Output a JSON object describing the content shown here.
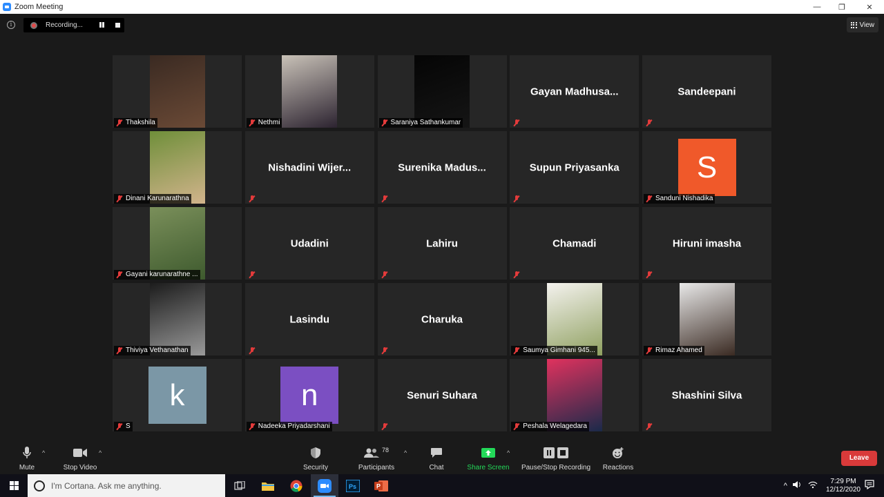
{
  "window": {
    "title": "Zoom Meeting",
    "minimize": "—",
    "maximize": "❐",
    "close": "✕"
  },
  "topbar": {
    "recording_label": "Recording...",
    "view_label": "View"
  },
  "tiles": [
    {
      "label": "Thakshila",
      "display": "photo",
      "colors": [
        "#3a2a22",
        "#6b4a36"
      ]
    },
    {
      "label": "Nethmi",
      "display": "photo",
      "colors": [
        "#c9c2b8",
        "#2c2330"
      ]
    },
    {
      "label": "Saraniya Sathankumar",
      "display": "photo",
      "colors": [
        "#050505",
        "#151515"
      ]
    },
    {
      "label": "",
      "display": "name",
      "name": "Gayan  Madhusa..."
    },
    {
      "label": "",
      "display": "name",
      "name": "Sandeepani"
    },
    {
      "label": "Dinani Karunarathna",
      "display": "photo",
      "colors": [
        "#6f8f3a",
        "#d2b48c"
      ]
    },
    {
      "label": "",
      "display": "name",
      "name": "Nishadini  Wijer..."
    },
    {
      "label": "",
      "display": "name",
      "name": "Surenika  Madus..."
    },
    {
      "label": "",
      "display": "name",
      "name": "Supun Priyasanka"
    },
    {
      "label": "Sanduni Nishadika",
      "display": "avatar",
      "letter": "S",
      "bg": "#f0592a"
    },
    {
      "label": "Gayani karunarathne ...",
      "display": "photo",
      "colors": [
        "#7a8f5a",
        "#3e5a2e"
      ]
    },
    {
      "label": "",
      "display": "name",
      "name": "Udadini"
    },
    {
      "label": "",
      "display": "name",
      "name": "Lahiru"
    },
    {
      "label": "",
      "display": "name",
      "name": "Chamadi"
    },
    {
      "label": "",
      "display": "name",
      "name": "Hiruni imasha"
    },
    {
      "label": "Thiviya Vethanathan",
      "display": "photo",
      "colors": [
        "#1c1c1c",
        "#9a9a9a"
      ]
    },
    {
      "label": "",
      "display": "name",
      "name": "Lasindu"
    },
    {
      "label": "",
      "display": "name",
      "name": "Charuka"
    },
    {
      "label": "Saumya  Gimhani 945...",
      "display": "photo",
      "colors": [
        "#f4f2ee",
        "#8fa060"
      ]
    },
    {
      "label": "Rimaz Ahamed",
      "display": "photo",
      "colors": [
        "#e8e8e8",
        "#3a2a22"
      ]
    },
    {
      "label": "S",
      "display": "avatar",
      "letter": "k",
      "bg": "#7b97a6"
    },
    {
      "label": "Nadeeka Priyadarshani",
      "display": "avatar",
      "letter": "n",
      "bg": "#7b4fc2"
    },
    {
      "label": "",
      "display": "name",
      "name": "Senuri Suhara"
    },
    {
      "label": "Peshala Welagedara",
      "display": "photo",
      "colors": [
        "#e0325e",
        "#1a2a4a"
      ]
    },
    {
      "label": "",
      "display": "name",
      "name": "Shashini Silva"
    }
  ],
  "toolbar": {
    "mute": "Mute",
    "stop_video": "Stop Video",
    "security": "Security",
    "participants": "Participants",
    "participant_count": "78",
    "chat": "Chat",
    "share_screen": "Share Screen",
    "pause_stop_recording": "Pause/Stop Recording",
    "reactions": "Reactions",
    "leave": "Leave",
    "share_color": "#23d959"
  },
  "taskbar": {
    "cortana_placeholder": "I'm Cortana. Ask me anything.",
    "time": "7:29 PM",
    "date": "12/12/2020"
  }
}
